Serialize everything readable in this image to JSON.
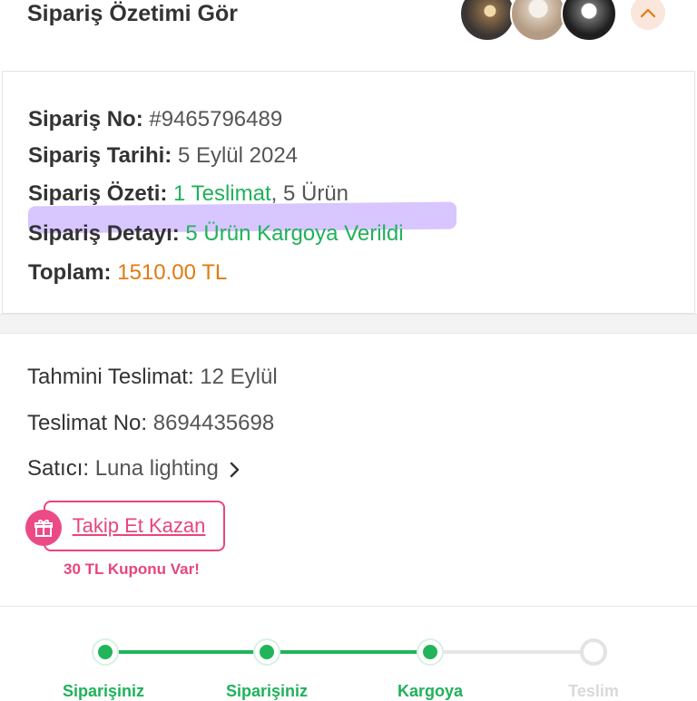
{
  "header": {
    "title": "Sipariş Özetimi Gör",
    "thumbnails": [
      "product-thumbnail-1",
      "product-thumbnail-2",
      "product-thumbnail-3"
    ],
    "toggle_icon": "chevron-up-icon"
  },
  "order": {
    "no_label": "Sipariş No:",
    "no_value": "#9465796489",
    "date_label": "Sipariş Tarihi:",
    "date_value": "5 Eylül 2024",
    "summary_label": "Sipariş Özeti:",
    "summary_delivery": "1 Teslimat",
    "summary_items": ", 5 Ürün",
    "detail_label": "Sipariş Detayı:",
    "detail_value": "5 Ürün Kargoya Verildi",
    "total_label": "Toplam:",
    "total_value": "1510.00 TL"
  },
  "shipment": {
    "eta_label": "Tahmini Teslimat:",
    "eta_value": "12 Eylül",
    "tracking_label": "Teslimat No:",
    "tracking_value": "8694435698",
    "seller_label": "Satıcı:",
    "seller_value": "Luna lighting",
    "follow_button": "Takip Et Kazan",
    "coupon_text": "30 TL Kuponu Var!"
  },
  "tracker": {
    "steps": [
      {
        "label": "Siparişiniz",
        "status": "done"
      },
      {
        "label": "Siparişiniz",
        "status": "done"
      },
      {
        "label": "Kargoya",
        "status": "done"
      },
      {
        "label": "Teslim",
        "status": "todo"
      }
    ]
  },
  "colors": {
    "accent_green": "#1fb25a",
    "accent_orange": "#e07b12",
    "accent_pink": "#e8457f",
    "highlight": "#c9b3ff"
  }
}
